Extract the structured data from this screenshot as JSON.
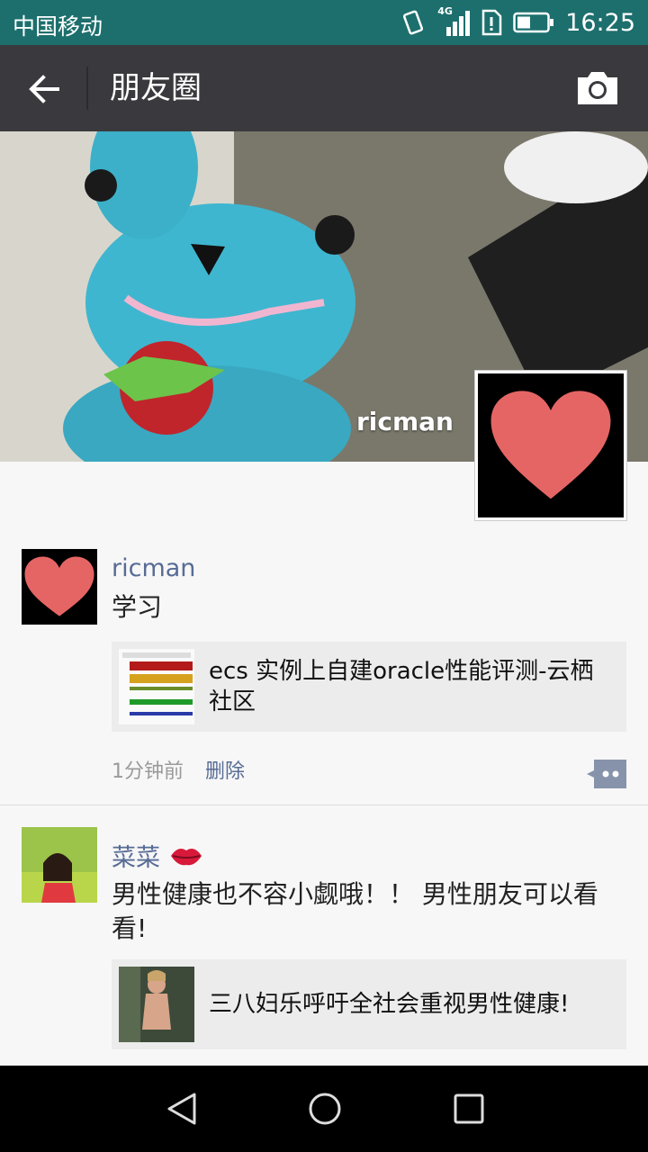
{
  "status_bar": {
    "carrier": "中国移动",
    "network": "4G",
    "time": "16:25"
  },
  "title_bar": {
    "title": "朋友圈",
    "back_icon": "arrow-left-icon",
    "camera_icon": "camera-icon"
  },
  "cover": {
    "user_name": "ricman"
  },
  "posts": [
    {
      "author": "ricman",
      "text": "学习",
      "link_title": "ecs 实例上自建oracle性能评测-云栖社区",
      "time": "1分钟前",
      "delete_label": "删除"
    },
    {
      "author": "菜菜",
      "text": "男性健康也不容小觑哦！！ 男性朋友可以看看!",
      "link_title": "三八妇乐呼吁全社会重视男性健康!"
    }
  ],
  "colors": {
    "status_bar": "#1c6f6d",
    "title_bar": "#3a3a3e",
    "author_name": "#576b95",
    "heart": "#e56565"
  }
}
